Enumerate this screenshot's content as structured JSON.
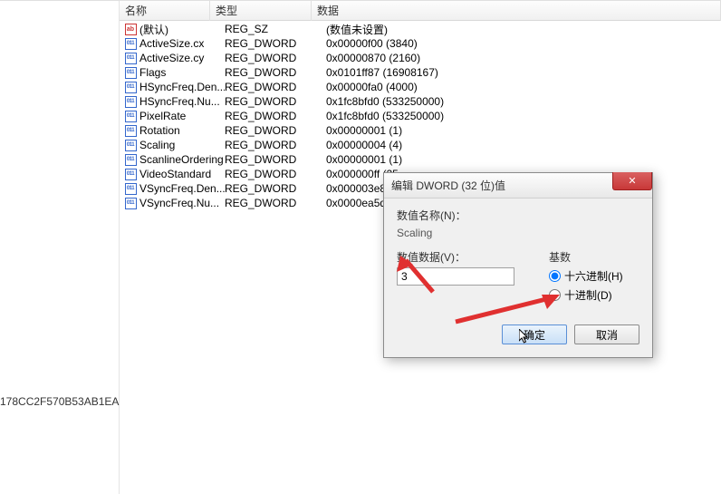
{
  "tree": {
    "visible_text": "178CC2F570B53AB1EA"
  },
  "columns": {
    "name": "名称",
    "type": "类型",
    "data": "数据"
  },
  "rows": [
    {
      "icon": "ab",
      "name": "(默认)",
      "type": "REG_SZ",
      "data": "(数值未设置)"
    },
    {
      "icon": "011",
      "name": "ActiveSize.cx",
      "type": "REG_DWORD",
      "data": "0x00000f00 (3840)"
    },
    {
      "icon": "011",
      "name": "ActiveSize.cy",
      "type": "REG_DWORD",
      "data": "0x00000870 (2160)"
    },
    {
      "icon": "011",
      "name": "Flags",
      "type": "REG_DWORD",
      "data": "0x0101ff87 (16908167)"
    },
    {
      "icon": "011",
      "name": "HSyncFreq.Den...",
      "type": "REG_DWORD",
      "data": "0x00000fa0 (4000)"
    },
    {
      "icon": "011",
      "name": "HSyncFreq.Nu...",
      "type": "REG_DWORD",
      "data": "0x1fc8bfd0 (533250000)"
    },
    {
      "icon": "011",
      "name": "PixelRate",
      "type": "REG_DWORD",
      "data": "0x1fc8bfd0 (533250000)"
    },
    {
      "icon": "011",
      "name": "Rotation",
      "type": "REG_DWORD",
      "data": "0x00000001 (1)"
    },
    {
      "icon": "011",
      "name": "Scaling",
      "type": "REG_DWORD",
      "data": "0x00000004 (4)"
    },
    {
      "icon": "011",
      "name": "ScanlineOrdering",
      "type": "REG_DWORD",
      "data": "0x00000001 (1)"
    },
    {
      "icon": "011",
      "name": "VideoStandard",
      "type": "REG_DWORD",
      "data": "0x000000ff (25"
    },
    {
      "icon": "011",
      "name": "VSyncFreq.Den...",
      "type": "REG_DWORD",
      "data": "0x000003e8 (1"
    },
    {
      "icon": "011",
      "name": "VSyncFreq.Nu...",
      "type": "REG_DWORD",
      "data": "0x0000ea5d (5"
    }
  ],
  "dialog": {
    "title": "编辑 DWORD (32 位)值",
    "close": "✕",
    "name_label": "数值名称(N)：",
    "name_value": "Scaling",
    "data_label": "数值数据(V)：",
    "data_value": "3",
    "base_label": "基数",
    "radio_hex": "十六进制(H)",
    "radio_dec": "十进制(D)",
    "ok": "确定",
    "cancel": "取消"
  }
}
